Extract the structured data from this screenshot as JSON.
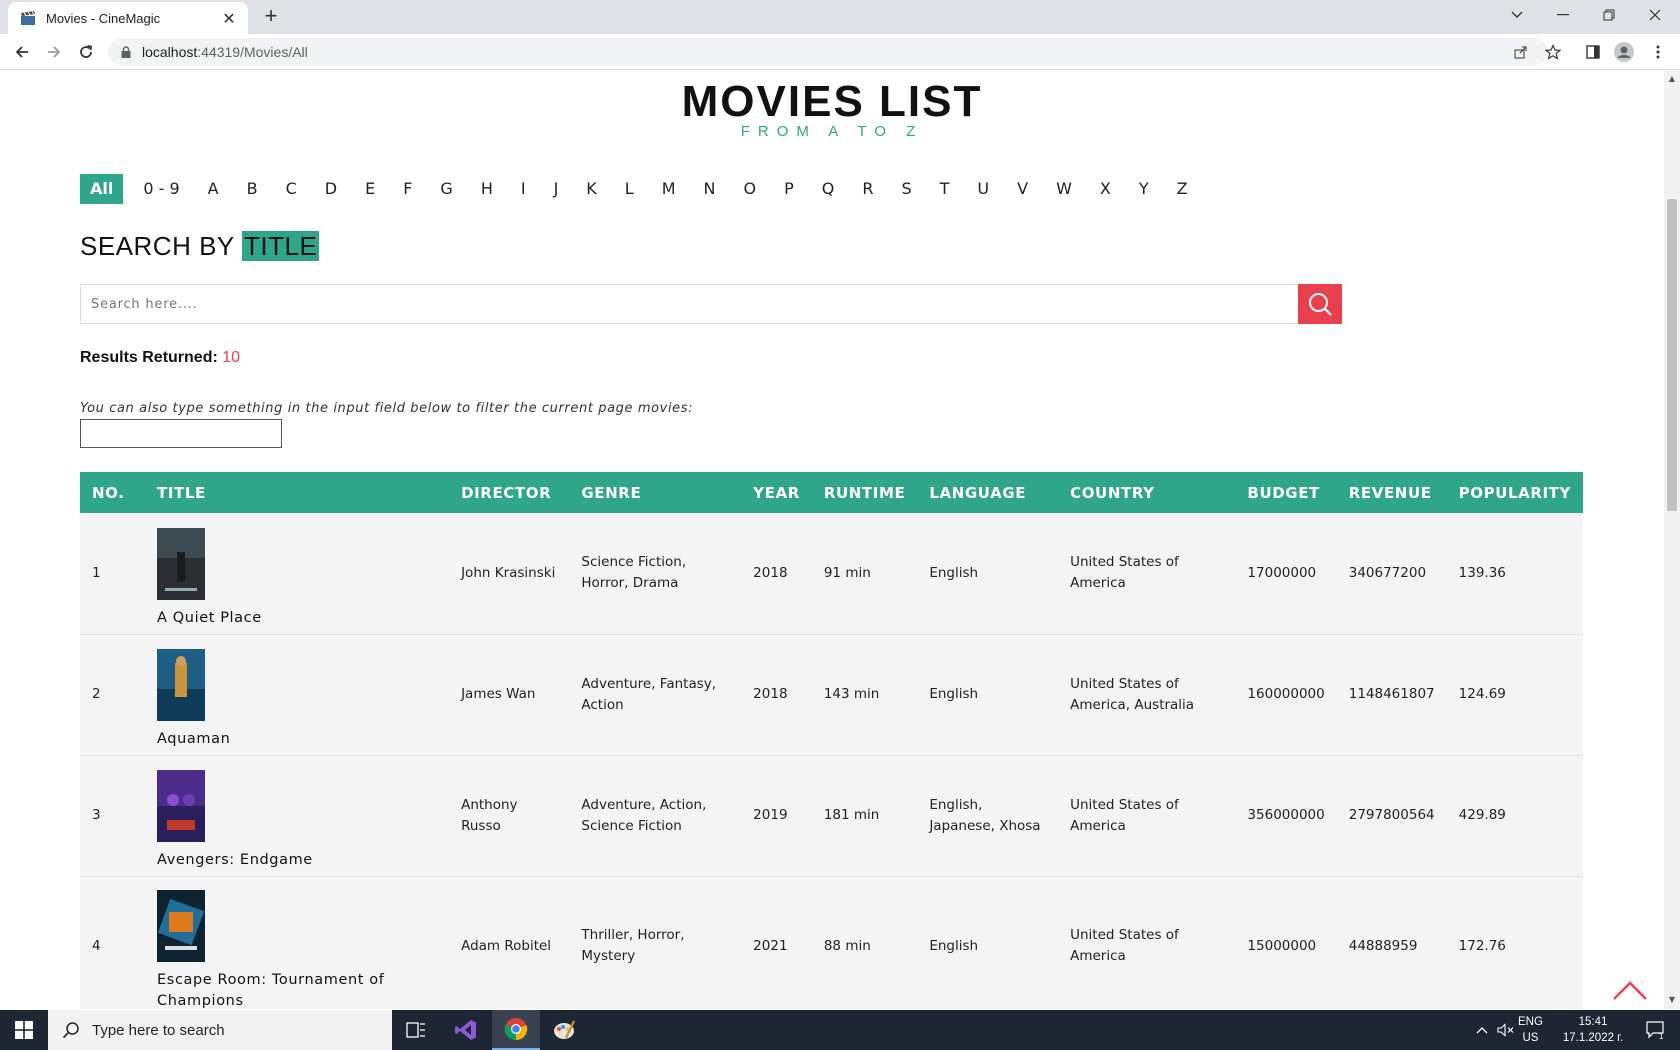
{
  "browser": {
    "tab_title": "Movies - CineMagic",
    "new_tab": "+",
    "url_host": "localhost",
    "url_rest": ":44319/Movies/All"
  },
  "page": {
    "title": "MOVIES LIST",
    "subtitle": "FROM A TO Z",
    "alphabet": [
      "All",
      "0 - 9",
      "A",
      "B",
      "C",
      "D",
      "E",
      "F",
      "G",
      "H",
      "I",
      "J",
      "K",
      "L",
      "M",
      "N",
      "O",
      "P",
      "Q",
      "R",
      "S",
      "T",
      "U",
      "V",
      "W",
      "X",
      "Y",
      "Z"
    ],
    "search_heading_prefix": "SEARCH BY ",
    "search_heading_highlight": "TITLE",
    "search_placeholder": "Search here....",
    "results_label": "Results Returned:",
    "results_count": "10",
    "filter_hint": "You can also type something in the input field below to filter the current page movies:",
    "accent_color": "#2fa58a",
    "danger_color": "#e8404f"
  },
  "table": {
    "headers": [
      "NO.",
      "TITLE",
      "DIRECTOR",
      "GENRE",
      "YEAR",
      "RUNTIME",
      "LANGUAGE",
      "COUNTRY",
      "BUDGET",
      "REVENUE",
      "POPULARITY"
    ],
    "rows": [
      {
        "no": "1",
        "title": "A Quiet Place",
        "director": "John Krasinski",
        "genre": "Science Fiction, Horror, Drama",
        "year": "2018",
        "runtime": "91 min",
        "language": "English",
        "country": "United States of America",
        "budget": "17000000",
        "revenue": "340677200",
        "popularity": "139.36"
      },
      {
        "no": "2",
        "title": "Aquaman",
        "director": "James Wan",
        "genre": "Adventure, Fantasy, Action",
        "year": "2018",
        "runtime": "143 min",
        "language": "English",
        "country": "United States of America, Australia",
        "budget": "160000000",
        "revenue": "1148461807",
        "popularity": "124.69"
      },
      {
        "no": "3",
        "title": "Avengers: Endgame",
        "director": "Anthony Russo",
        "genre": "Adventure, Action, Science Fiction",
        "year": "2019",
        "runtime": "181 min",
        "language": "English, Japanese, Xhosa",
        "country": "United States of America",
        "budget": "356000000",
        "revenue": "2797800564",
        "popularity": "429.89"
      },
      {
        "no": "4",
        "title": "Escape Room: Tournament of Champions",
        "director": "Adam Robitel",
        "genre": "Thriller, Horror, Mystery",
        "year": "2021",
        "runtime": "88 min",
        "language": "English",
        "country": "United States of America",
        "budget": "15000000",
        "revenue": "44888959",
        "popularity": "172.76"
      }
    ]
  },
  "taskbar": {
    "search_placeholder": "Type here to search",
    "lang_line1": "ENG",
    "lang_line2": "US",
    "time": "15:41",
    "date": "17.1.2022 г.",
    "notification_count": "1"
  }
}
